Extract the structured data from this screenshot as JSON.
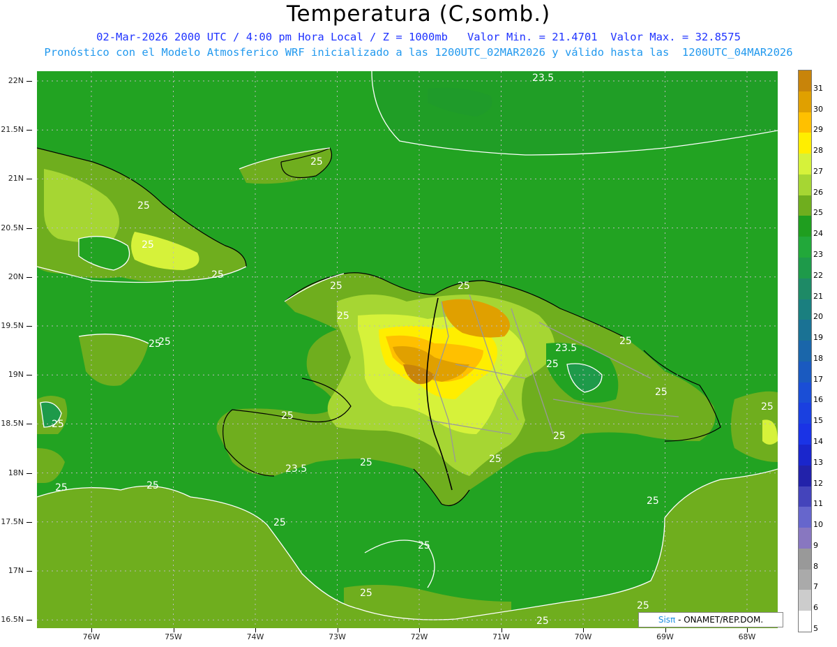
{
  "title": "Temperatura (C,somb.)",
  "subtitle_line1": "02-Mar-2026 2000 UTC / 4:00 pm Hora Local / Z = 1000mb   Valor Min. = 21.4701  Valor Max. = 32.8575",
  "subtitle_line2": "Pronóstico con el Modelo Atmosferico WRF inicializado a las 1200UTC_02MAR2026 y válido hasta las  1200UTC_04MAR2026",
  "lat_labels": [
    "22N",
    "21.5N",
    "21N",
    "20.5N",
    "20N",
    "19.5N",
    "19N",
    "18.5N",
    "18N",
    "17.5N",
    "17N",
    "16.5N"
  ],
  "lon_labels": [
    "76W",
    "75W",
    "74W",
    "73W",
    "72W",
    "71W",
    "70W",
    "69W",
    "68W"
  ],
  "colorbar": {
    "labels": [
      "31",
      "30",
      "29",
      "28",
      "27",
      "26",
      "25",
      "24",
      "23",
      "22",
      "21",
      "20",
      "19",
      "18",
      "17",
      "16",
      "15",
      "14",
      "13",
      "12",
      "11",
      "10",
      "9",
      "8",
      "7",
      "6",
      "5"
    ],
    "colors": [
      "#c8840a",
      "#e0a000",
      "#ffc000",
      "#ffee00",
      "#d6f23a",
      "#a6d633",
      "#6fae1e",
      "#1f9e1f",
      "#22a83a",
      "#1e9a4a",
      "#1e8a66",
      "#1a7f7f",
      "#1a7294",
      "#1a66aa",
      "#1a5ac0",
      "#1a4ed6",
      "#1a40e0",
      "#1a33e6",
      "#1a26cc",
      "#2222aa",
      "#4444bb",
      "#6666cc",
      "#8877c0",
      "#999999",
      "#aaaaaa",
      "#cccccc",
      "#ffffff"
    ]
  },
  "contour_labels": [
    {
      "text": "23.5"
    },
    {
      "text": "25"
    },
    {
      "text": "25"
    },
    {
      "text": "25"
    },
    {
      "text": "25"
    },
    {
      "text": "25"
    },
    {
      "text": "25"
    },
    {
      "text": "25"
    },
    {
      "text": "23.5"
    },
    {
      "text": "25"
    },
    {
      "text": "25"
    },
    {
      "text": "25"
    },
    {
      "text": "25"
    },
    {
      "text": "25"
    },
    {
      "text": "25"
    },
    {
      "text": "23.5"
    },
    {
      "text": "25"
    },
    {
      "text": "25"
    },
    {
      "text": "25"
    },
    {
      "text": "25"
    },
    {
      "text": "25"
    },
    {
      "text": "25"
    },
    {
      "text": "25"
    },
    {
      "text": "25"
    },
    {
      "text": "25"
    },
    {
      "text": "25"
    },
    {
      "text": "25"
    },
    {
      "text": "25"
    },
    {
      "text": "25"
    }
  ],
  "credit": {
    "sis": "Sisπ",
    "rest": " - ONAMET/REP.DOM."
  }
}
